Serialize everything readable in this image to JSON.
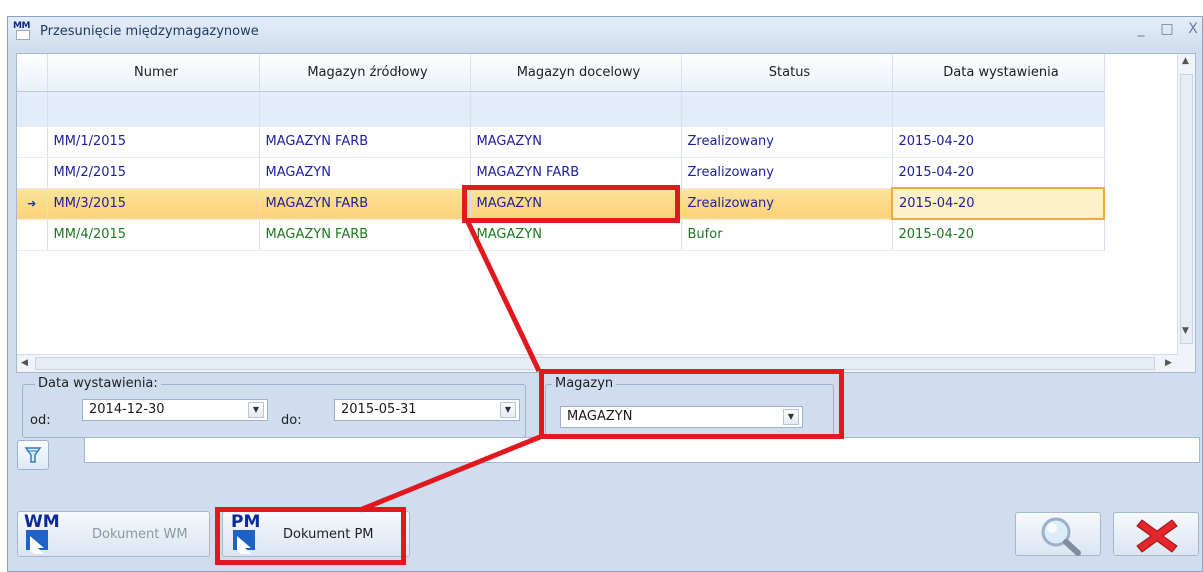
{
  "window": {
    "title": "Przesunięcie międzymagazynowe",
    "icon_code": "MM",
    "minimize_glyph": "_",
    "maximize_glyph": "□",
    "close_glyph": "X"
  },
  "grid": {
    "columns": [
      "Numer",
      "Magazyn źródłowy",
      "Magazyn docelowy",
      "Status",
      "Data wystawienia"
    ],
    "rows": [
      {
        "numer": "MM/1/2015",
        "zrodlowy": "MAGAZYN FARB",
        "docelowy": "MAGAZYN",
        "status": "Zrealizowany",
        "data": "2015-04-20"
      },
      {
        "numer": "MM/2/2015",
        "zrodlowy": "MAGAZYN",
        "docelowy": "MAGAZYN FARB",
        "status": "Zrealizowany",
        "data": "2015-04-20"
      },
      {
        "numer": "MM/3/2015",
        "zrodlowy": "MAGAZYN FARB",
        "docelowy": "MAGAZYN",
        "status": "Zrealizowany",
        "data": "2015-04-20"
      },
      {
        "numer": "MM/4/2015",
        "zrodlowy": "MAGAZYN FARB",
        "docelowy": "MAGAZYN",
        "status": "Bufor",
        "data": "2015-04-20"
      }
    ],
    "selected_indicator": "➜"
  },
  "filters": {
    "date_group_label": "Data wystawienia:",
    "from_label": "od:",
    "from_value": "2014-12-30",
    "to_label": "do:",
    "to_value": "2015-05-31",
    "warehouse_group_label": "Magazyn",
    "warehouse_value": "MAGAZYN",
    "search_value": ""
  },
  "buttons": {
    "wm_code": "WM",
    "wm_label": "Dokument WM",
    "pm_code": "PM",
    "pm_label": "Dokument PM"
  },
  "colors": {
    "highlight": "#e1181e",
    "selected_row": "#fbd278",
    "text_blue": "#21219c",
    "text_green": "#1d7a1d"
  }
}
